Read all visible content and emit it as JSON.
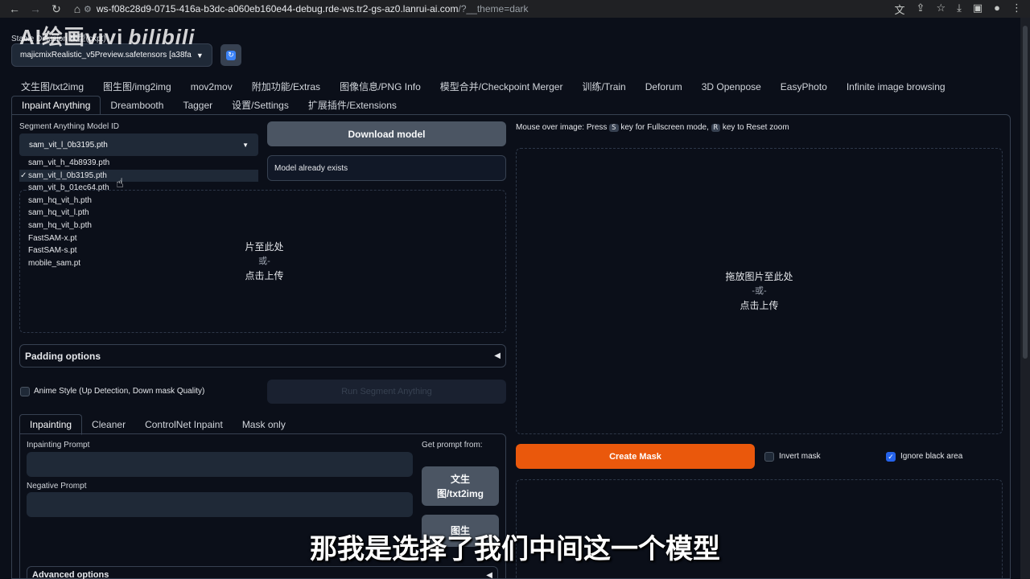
{
  "browser": {
    "url_host": "ws-f08c28d9-0715-416a-b3dc-a060eb160e44-debug.rde-ws.tr2-gs-az0.lanrui-ai.com",
    "url_path": "/?__theme=dark"
  },
  "watermark": {
    "text": "AI绘画vivi",
    "brand": "bilibili"
  },
  "checkpoint": {
    "label": "Stable Diffusion 模型(ckpt)",
    "value": "majicmixRealistic_v5Preview.safetensors [a38fa"
  },
  "top_tabs": [
    "文生图/txt2img",
    "图生图/img2img",
    "mov2mov",
    "附加功能/Extras",
    "图像信息/PNG Info",
    "模型合并/Checkpoint Merger",
    "训练/Train",
    "Deforum",
    "3D Openpose",
    "EasyPhoto",
    "Infinite image browsing"
  ],
  "second_tabs": [
    "Inpaint Anything",
    "Dreambooth",
    "Tagger",
    "设置/Settings",
    "扩展插件/Extensions"
  ],
  "sam": {
    "label": "Segment Anything Model ID",
    "selected": "sam_vit_l_0b3195.pth",
    "options": [
      "sam_vit_h_4b8939.pth",
      "sam_vit_l_0b3195.pth",
      "sam_vit_b_01ec64.pth",
      "sam_hq_vit_h.pth",
      "sam_hq_vit_l.pth",
      "sam_hq_vit_b.pth",
      "FastSAM-x.pt",
      "FastSAM-s.pt",
      "mobile_sam.pt"
    ],
    "download_label": "Download model",
    "status": "Model already exists"
  },
  "upload_left": {
    "line1": "片至此处",
    "line2": "或-",
    "line3": "点击上传"
  },
  "upload_right": {
    "line1": "拖放图片至此处",
    "line2": "-或-",
    "line3": "点击上传"
  },
  "padding_label": "Padding options",
  "anime_label": "Anime Style (Up Detection, Down mask Quality)",
  "run_sam_label": "Run Segment Anything",
  "inpaint_tabs": [
    "Inpainting",
    "Cleaner",
    "ControlNet Inpaint",
    "Mask only"
  ],
  "inpaint": {
    "prompt_label": "Inpainting Prompt",
    "negative_label": "Negative Prompt",
    "get_prompt_label": "Get prompt from:",
    "txt2img_line1": "文生",
    "txt2img_line2": "图/txt2img",
    "img2img_line1": "图生",
    "advanced_label": "Advanced options"
  },
  "right": {
    "hint_pre": "Mouse over image: Press",
    "hint_key1": "S",
    "hint_mid": "key for Fullscreen mode,",
    "hint_key2": "R",
    "hint_post": "key to Reset zoom",
    "create_mask": "Create Mask",
    "invert_mask": "Invert mask",
    "ignore_black": "Ignore black area",
    "ignore_black_checked": true
  },
  "subtitle": "那我是选择了我们中间这一个模型",
  "colors": {
    "accent_orange": "#ea580c",
    "checkbox_blue": "#2563eb",
    "background": "#0b0f19"
  }
}
